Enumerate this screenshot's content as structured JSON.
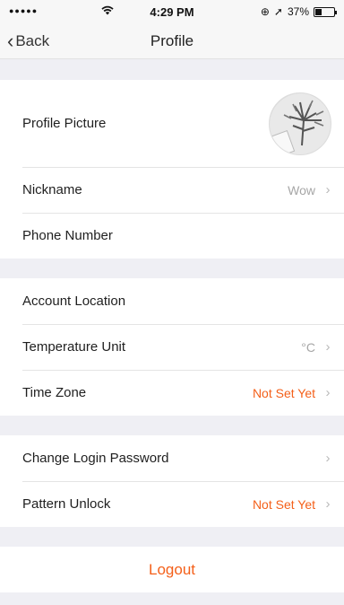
{
  "status": {
    "signal": "●●●●●",
    "time": "4:29 PM",
    "battery_percent": "37%",
    "battery_level": 0.37
  },
  "nav": {
    "back_label": "Back",
    "title": "Profile"
  },
  "section1": {
    "profile_picture_label": "Profile Picture",
    "nickname_label": "Nickname",
    "nickname_value": "Wow",
    "phone_label": "Phone Number"
  },
  "section2": {
    "account_location_label": "Account Location",
    "temperature_label": "Temperature Unit",
    "temperature_value": "°C",
    "timezone_label": "Time Zone",
    "timezone_value": "Not Set Yet"
  },
  "section3": {
    "password_label": "Change Login Password",
    "pattern_label": "Pattern Unlock",
    "pattern_value": "Not Set Yet"
  },
  "logout_label": "Logout",
  "colors": {
    "accent": "#f4601a",
    "background": "#efeff4",
    "muted": "#a6a6a6"
  }
}
